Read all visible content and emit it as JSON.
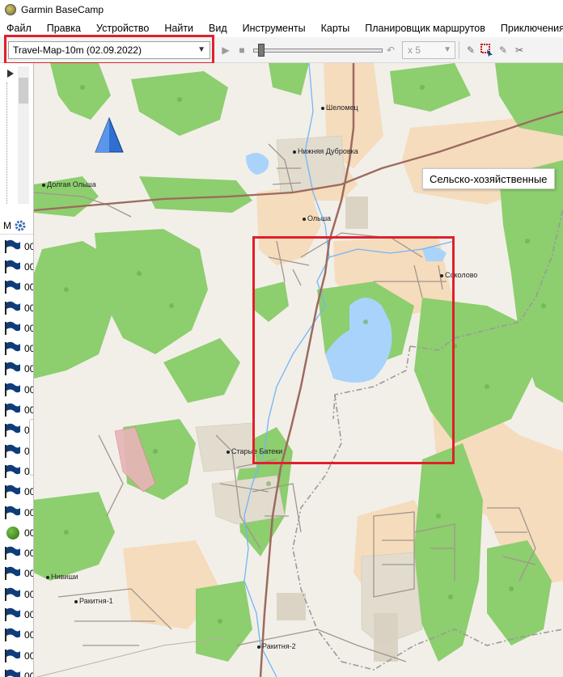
{
  "window": {
    "title": "Garmin BaseCamp"
  },
  "menu": [
    "Файл",
    "Правка",
    "Устройство",
    "Найти",
    "Вид",
    "Инструменты",
    "Карты",
    "Планировщик маршрутов",
    "Приключения"
  ],
  "toolbar": {
    "map_product": "Travel-Map-10m (02.09.2022)",
    "speed": "x 5"
  },
  "sidebar": {
    "header_label": "M",
    "items": [
      {
        "type": "flag",
        "label": "00"
      },
      {
        "type": "flag",
        "label": "00"
      },
      {
        "type": "flag",
        "label": "00"
      },
      {
        "type": "flag",
        "label": "00"
      },
      {
        "type": "flag",
        "label": "00"
      },
      {
        "type": "flag",
        "label": "00"
      },
      {
        "type": "flag",
        "label": "00"
      },
      {
        "type": "flag",
        "label": "00"
      },
      {
        "type": "flag",
        "label": "00"
      },
      {
        "type": "flag",
        "label": "00"
      },
      {
        "type": "flag",
        "label": "00"
      },
      {
        "type": "flag",
        "label": "00"
      },
      {
        "type": "flag",
        "label": "00"
      },
      {
        "type": "flag",
        "label": "00"
      },
      {
        "type": "dot",
        "label": "00"
      },
      {
        "type": "flag",
        "label": "00"
      },
      {
        "type": "flag",
        "label": "00"
      },
      {
        "type": "flag",
        "label": "00"
      },
      {
        "type": "flag",
        "label": "00"
      },
      {
        "type": "flag",
        "label": "00"
      },
      {
        "type": "flag",
        "label": "00"
      },
      {
        "type": "flag",
        "label": "00"
      }
    ]
  },
  "map": {
    "tooltip": "Сельско-хозяйственные",
    "places": {
      "shelomets": "Шеломец",
      "nizhnyaya_dubrovka": "Нижняя Дубровка",
      "dolgaya_olsha": "Долгая Ольша",
      "olsha": "Ольша",
      "sokolovo": "Соколово",
      "starye_bateki": "Старые Батеки",
      "nivishi": "Нивиши",
      "rakitnya_1": "Ракитня-1",
      "rakitnya_2": "Ракитня-2"
    }
  },
  "colors": {
    "map_background": "#f2efe9",
    "forest": "#8dce6e",
    "farmland": "#f5dcbd",
    "water": "#a9d3fb",
    "road_main": "#9d6a5e",
    "highlight": "#e0202a",
    "flag": "#0f3d7a"
  }
}
